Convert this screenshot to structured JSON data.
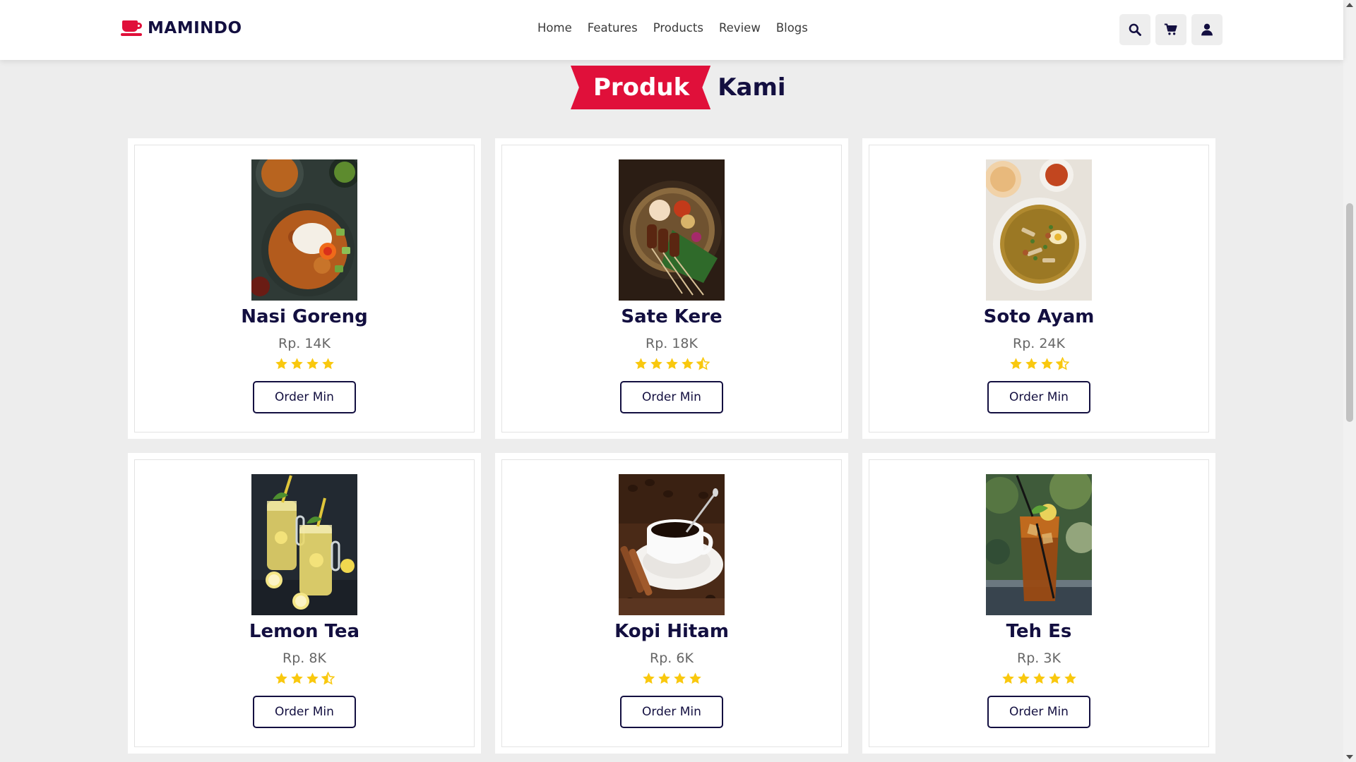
{
  "brand": {
    "name": "MAMINDO",
    "color": "#e0103a"
  },
  "nav": {
    "items": [
      {
        "label": "Home"
      },
      {
        "label": "Features"
      },
      {
        "label": "Products"
      },
      {
        "label": "Review"
      },
      {
        "label": "Blogs"
      }
    ]
  },
  "actions": [
    {
      "icon": "search-icon"
    },
    {
      "icon": "cart-icon"
    },
    {
      "icon": "user-icon"
    }
  ],
  "section": {
    "title_highlight": "Produk",
    "title_rest": "Kami"
  },
  "products": [
    {
      "name": "Nasi Goreng",
      "price": "Rp. 14K",
      "rating": 4,
      "button": "Order Min",
      "image": "nasi-goreng-photo"
    },
    {
      "name": "Sate Kere",
      "price": "Rp. 18K",
      "rating": 4.5,
      "button": "Order Min",
      "image": "sate-kere-photo"
    },
    {
      "name": "Soto Ayam",
      "price": "Rp. 24K",
      "rating": 3.5,
      "button": "Order Min",
      "image": "soto-ayam-photo"
    },
    {
      "name": "Lemon Tea",
      "price": "Rp. 8K",
      "rating": 3.5,
      "button": "Order Min",
      "image": "lemon-tea-photo"
    },
    {
      "name": "Kopi Hitam",
      "price": "Rp. 6K",
      "rating": 4,
      "button": "Order Min",
      "image": "kopi-hitam-photo"
    },
    {
      "name": "Teh Es",
      "price": "Rp. 3K",
      "rating": 5,
      "button": "Order Min",
      "image": "teh-es-photo"
    }
  ],
  "colors": {
    "accent": "#e0103a",
    "text_dark": "#130f40",
    "star": "#f9c80e",
    "page_bg": "#ededed"
  }
}
